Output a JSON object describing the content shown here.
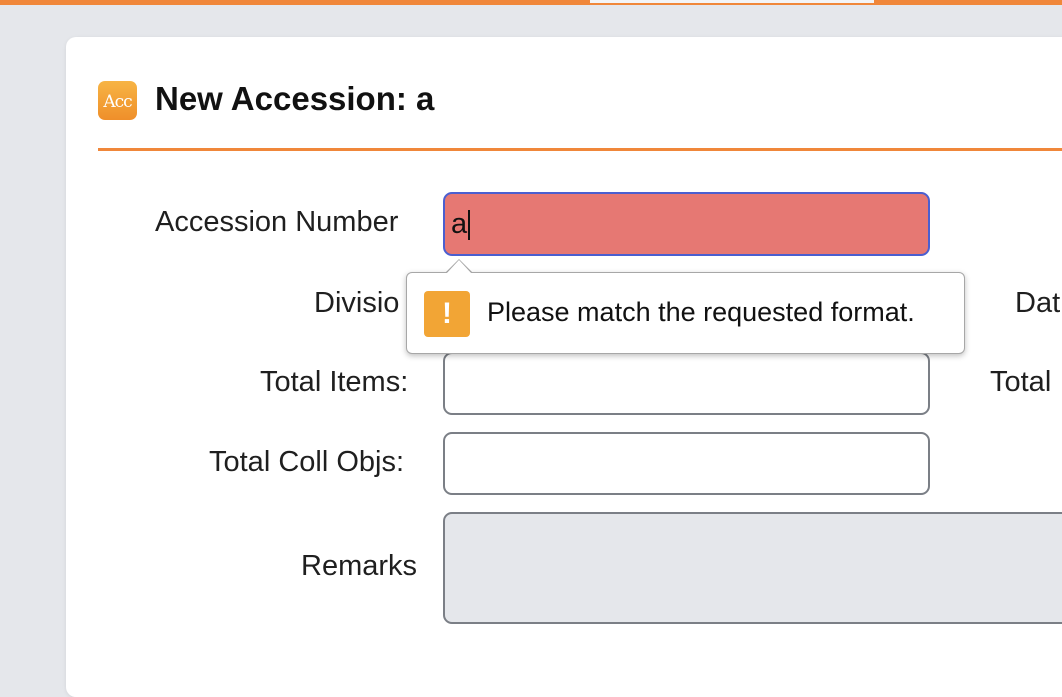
{
  "window": {
    "title": "New Accession: a",
    "icon_text": "Acc",
    "icon": "accession-app-icon",
    "accent_color": "#f0873a"
  },
  "form": {
    "accession_number": {
      "label": "Accession Number",
      "value": "a",
      "state": "invalid"
    },
    "division": {
      "label": "Divisio"
    },
    "date_right": {
      "label": "Dat"
    },
    "total_items": {
      "label": "Total Items:",
      "value": ""
    },
    "total_right": {
      "label": "Total"
    },
    "total_coll_objs": {
      "label": "Total Coll Objs:",
      "value": ""
    },
    "remarks": {
      "label": "Remarks",
      "value": ""
    }
  },
  "validation_tooltip": {
    "icon": "warning-icon",
    "icon_glyph": "!",
    "message": "Please match the requested format.",
    "icon_color": "#f2a535",
    "invalid_field_color": "#e67873"
  }
}
